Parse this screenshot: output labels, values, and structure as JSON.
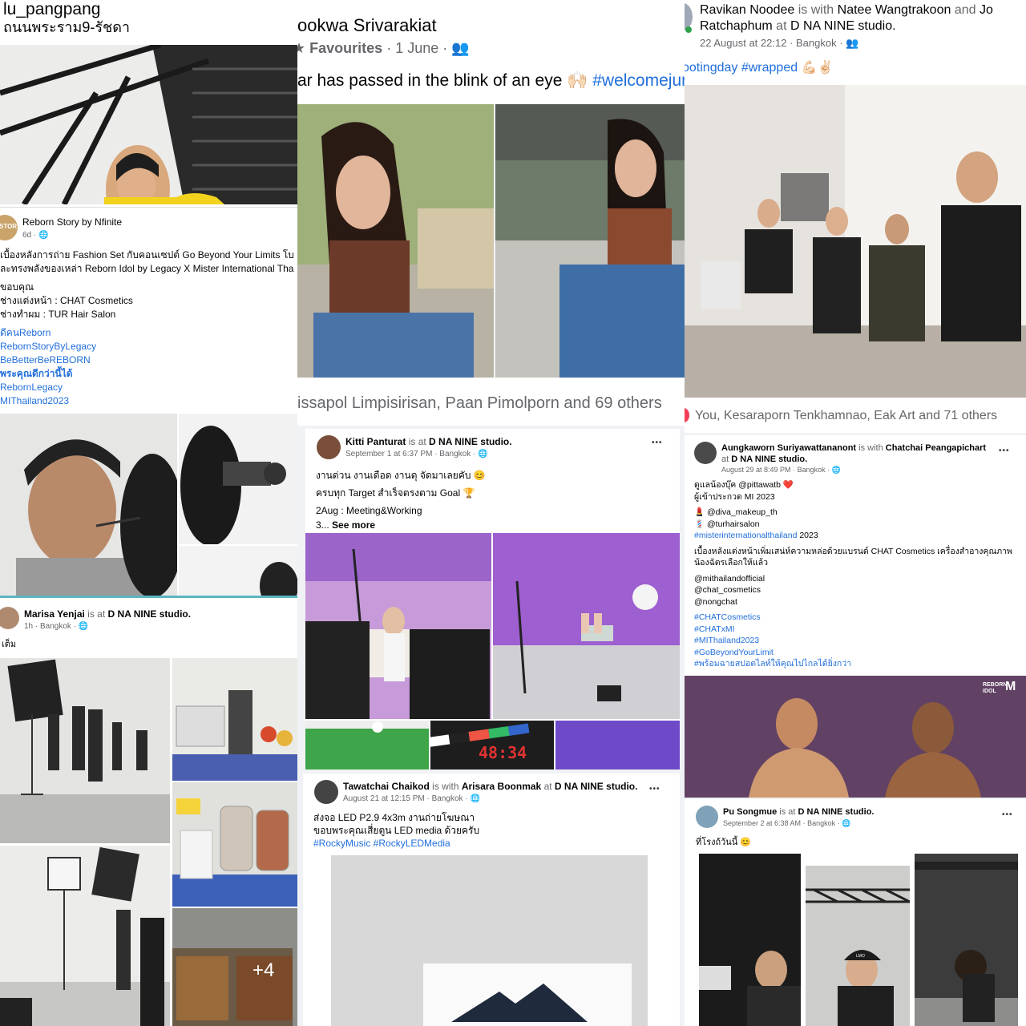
{
  "colors": {
    "link": "#216fdb",
    "text": "#050505",
    "muted": "#65676b",
    "online": "#31a24c",
    "divider": "#dddddd",
    "accent_teal": "#5bb6c2"
  },
  "panel1": {
    "header": {
      "username": "lu_pangpang",
      "location": "ถนนพระราม9-รัชดา"
    },
    "post": {
      "author": "Reborn Story by Nfinite",
      "avatar_text": "STORY",
      "time": "6d",
      "privacy_icon": "globe-icon",
      "lines": [
        "เบื้องหลังการถ่าย Fashion Set กับคอนเซปต์ Go Beyond Your Limits โบ",
        "ละทรงพลังของเหล่า Reborn Idol by Legacy X Mister International Tha",
        "ขอบคุณ",
        "ช่างแต่งหน้า : CHAT Cosmetics",
        "ช่างทำผม : TUR Hair Salon"
      ],
      "hashtags": [
        "ดีคนReborn",
        "RebornStoryByLegacy",
        "BeBetterBeREBORN",
        "พระคุณดีกว่านี้ได้",
        "RebornLegacy",
        "MIThailand2023"
      ]
    },
    "post2": {
      "author": "Marisa Yenjai",
      "is_at": "is at",
      "place": "D NA NINE studio.",
      "time": "1h",
      "location": "Bangkok",
      "privacy_icon": "globe-icon",
      "text": "เต็ม",
      "more_count": "+4"
    }
  },
  "panel2": {
    "header": {
      "name": "ookwa Srivarakiat",
      "favourites": "Favourites",
      "date": "1 June",
      "privacy_icon": "friends-icon",
      "caption": "ar has passed in the blink of an eye",
      "caption_emoji": "🙌🏻",
      "hashtag": "#welcomejune",
      "reactions": "issapol Limpisirisan, Paan Pimolporn and 69 others"
    },
    "post1": {
      "author": "Kitti Panturat",
      "is_at": "is at",
      "place": "D NA NINE studio.",
      "time": "September 1 at 6:37 PM",
      "location": "Bangkok",
      "privacy_icon": "globe-icon",
      "line1": "งานด่วน งานเดือด งานดุ จัดมาเลยคับ",
      "emoji1": "😊",
      "line2": "ครบทุก Target สำเร็จตรงตาม Goal",
      "emoji2": "🏆",
      "line3": "2Aug : Meeting&Working",
      "line4": "3...",
      "see_more": "See more",
      "menu": "•••",
      "clapper_text": "48:34"
    },
    "post2": {
      "author": "Tawatchai Chaikod",
      "is_with": "is with",
      "with_name": "Arisara Boonmak",
      "at": "at",
      "place": "D NA NINE studio.",
      "time": "August 21 at 12:15 PM",
      "location": "Bangkok",
      "privacy_icon": "globe-icon",
      "line1": "ส่งจอ LED P2.9  4x3m งานถ่ายโฆษณา",
      "line2": "ขอบพระคุณเสี่ยตูน LED media ด้วยครับ",
      "hashtags": "#RockyMusic #RockyLEDMedia",
      "menu": "•••"
    }
  },
  "panel3": {
    "header": {
      "author": "Ravikan Noodee",
      "is_with": "is with",
      "with1": "Natee Wangtrakoon",
      "and": "and",
      "with2": "Jo Ratchaphum",
      "at": "at",
      "place": "D NA NINE studio.",
      "time": "22 August at 22:12",
      "location": "Bangkok",
      "privacy_icon": "friends-icon",
      "hashtags": "ootingday #wrapped",
      "emoji": "💪🏻✌🏻",
      "reactions": "You, Kesaraporn Tenkhamnao, Eak Art and 71 others"
    },
    "post1": {
      "author": "Aungkaworn Suriyawattananont",
      "is_with": "is with",
      "with_name": "Chatchai Peangapichart",
      "at": "at",
      "place": "D NA NINE studio.",
      "time": "August 29 at 8:49 PM",
      "location": "Bangkok",
      "privacy_icon": "globe-icon",
      "menu": "•••",
      "line1": "ดูแลน้องบุ๊ค @pittawatb",
      "line1_emoji": "❤️",
      "line2": "ผู้เข้าประกวด MI 2023",
      "lipstick": "💄",
      "makeup": "@diva_makeup_th",
      "barber": "💈",
      "hair": "@turhairsalon",
      "hashtag_main": "#misterinternationalthailand",
      "hashtag_year": "2023",
      "para1": "เบื้องหลังแต่งหน้าเพิ่มเสน่ห์ความหล่อด้วยแบรนด์ CHAT Cosmetics เครื่องสำอางคุณภาพ",
      "para2": "น้องฉัตรเลือกให้แล้ว",
      "mentions": [
        "@mithailandofficial",
        "@chat_cosmetics",
        "@nongchat"
      ],
      "hashtags": [
        "#CHATCosmetics",
        "#CHATxMI",
        "#MIThailand2023",
        "#GoBeyondYourLimit",
        "#พร้อมฉายสปอตไลท์ให้คุณไปไกลได้ยิ่งกว่า"
      ],
      "brand_logo": "REBORN IDOL",
      "brand_logo2": "M"
    },
    "post2": {
      "author": "Pu Songmue",
      "is_at": "is at",
      "place": "D NA NINE studio.",
      "time": "September 2 at 6:38 AM",
      "location": "Bangkok",
      "privacy_icon": "globe-icon",
      "text": "ที่โรงถ้วันนี้",
      "emoji": "😊",
      "menu": "•••",
      "cap_text": "LMO"
    }
  }
}
